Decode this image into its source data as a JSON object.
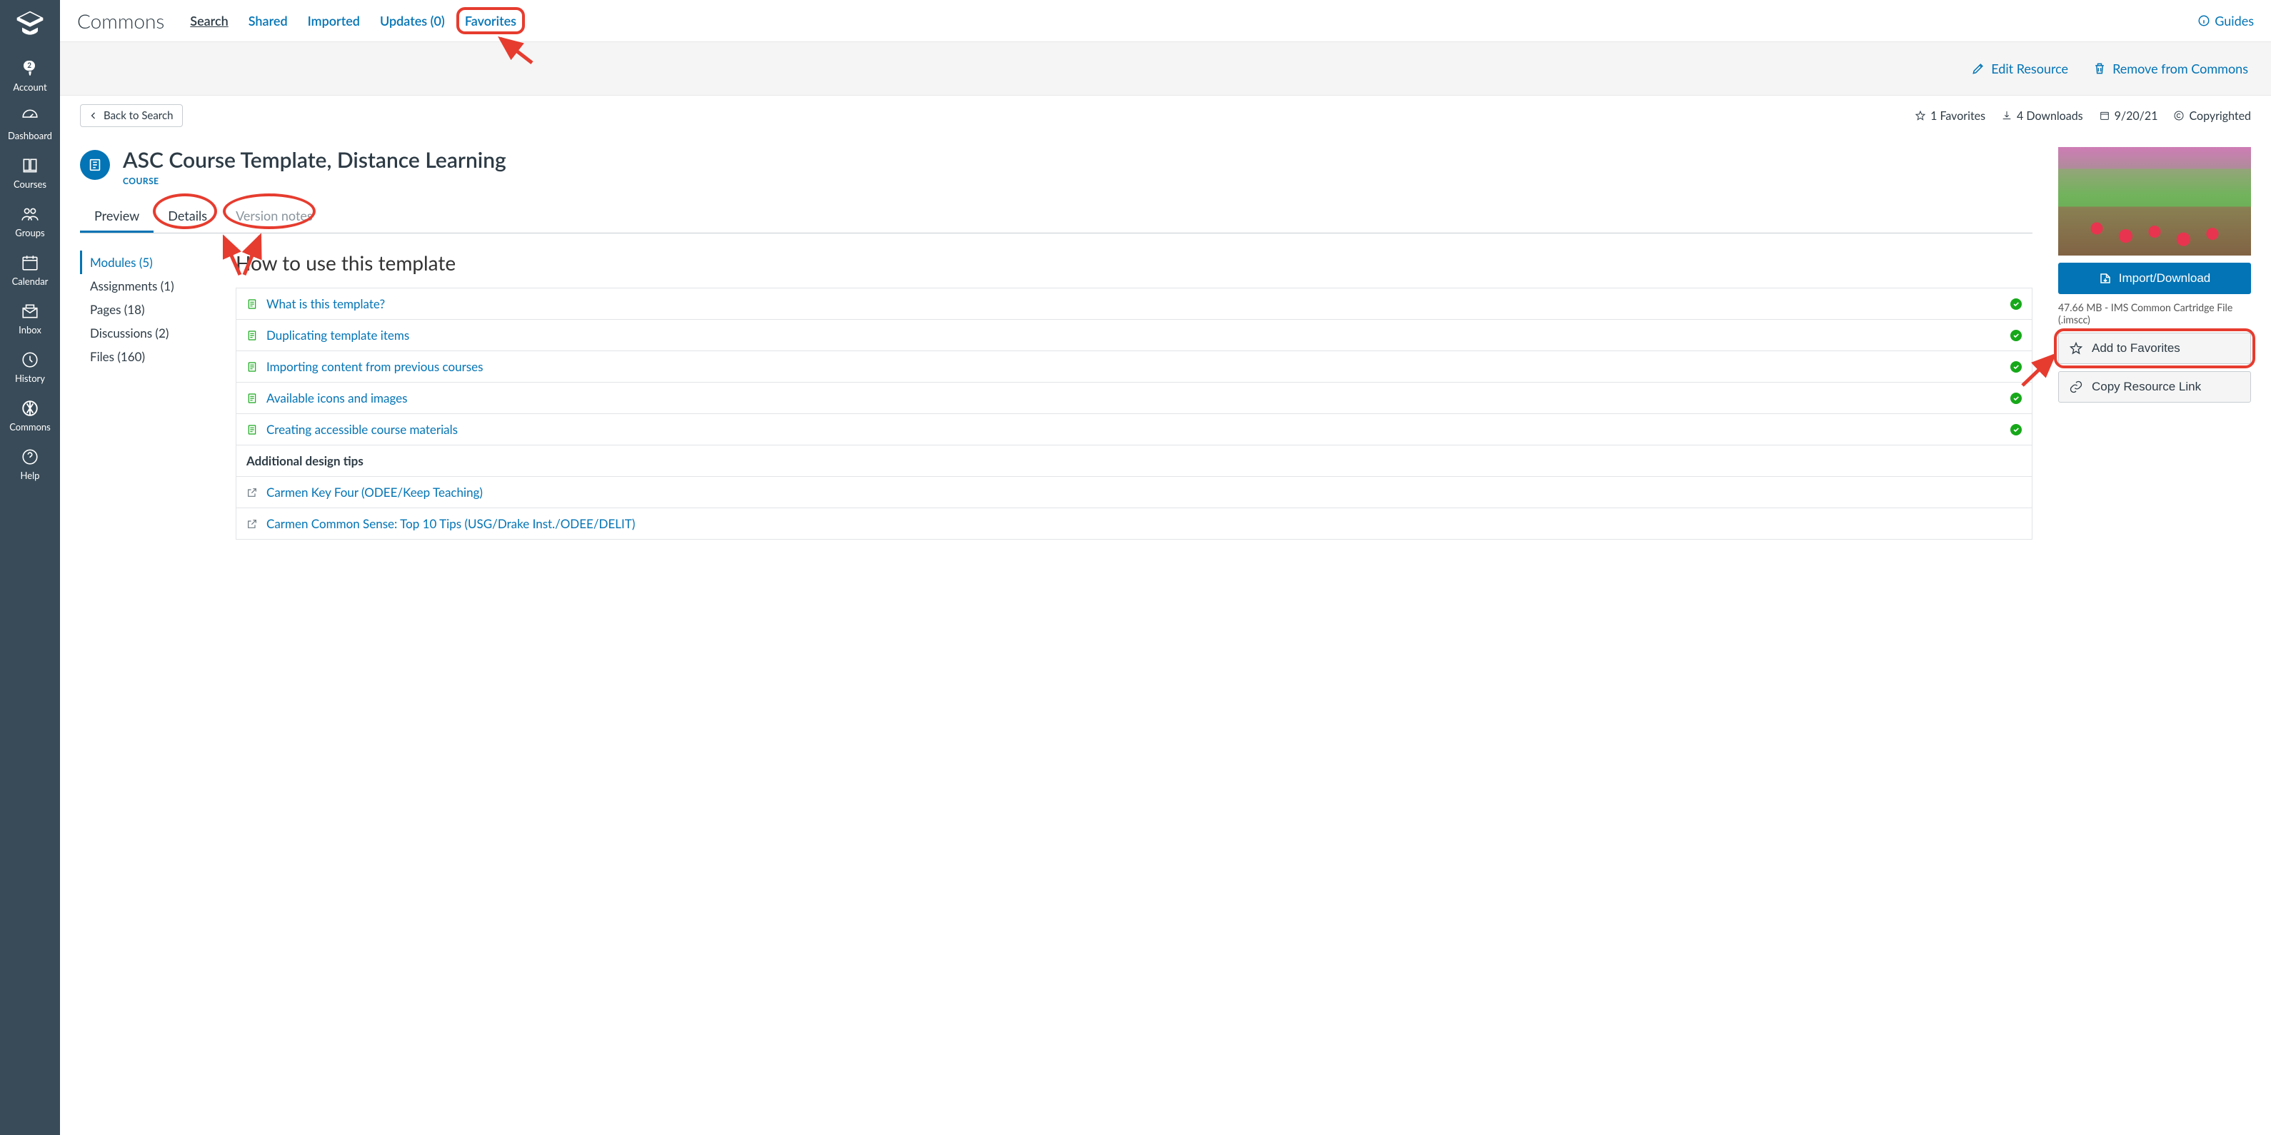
{
  "globalNav": {
    "badge": "2",
    "items": [
      {
        "label": "Account"
      },
      {
        "label": "Dashboard"
      },
      {
        "label": "Courses"
      },
      {
        "label": "Groups"
      },
      {
        "label": "Calendar"
      },
      {
        "label": "Inbox"
      },
      {
        "label": "History"
      },
      {
        "label": "Commons"
      },
      {
        "label": "Help"
      }
    ]
  },
  "header": {
    "title": "Commons",
    "tabs": {
      "search": "Search",
      "shared": "Shared",
      "imported": "Imported",
      "updates": "Updates (0)",
      "favorites": "Favorites"
    },
    "guides": "Guides"
  },
  "actionBar": {
    "edit": "Edit Resource",
    "remove": "Remove from Commons"
  },
  "backRow": {
    "back": "Back to Search",
    "favorites": "1 Favorites",
    "downloads": "4 Downloads",
    "date": "9/20/21",
    "license": "Copyrighted"
  },
  "resource": {
    "title": "ASC Course Template, Distance Learning",
    "type": "COURSE",
    "tabs": {
      "preview": "Preview",
      "details": "Details",
      "version": "Version notes"
    }
  },
  "moduleNav": {
    "modules": "Modules (5)",
    "assignments": "Assignments (1)",
    "pages": "Pages (18)",
    "discussions": "Discussions (2)",
    "files": "Files (160)"
  },
  "preview": {
    "heading": "How to use this template",
    "items": [
      {
        "label": "What is this template?",
        "type": "page",
        "check": true
      },
      {
        "label": "Duplicating template items",
        "type": "page",
        "check": true
      },
      {
        "label": "Importing content from previous courses",
        "type": "page",
        "check": true
      },
      {
        "label": "Available icons and images",
        "type": "page",
        "check": true
      },
      {
        "label": "Creating accessible course materials",
        "type": "page",
        "check": true
      }
    ],
    "subhead": "Additional design tips",
    "extItems": [
      {
        "label": "Carmen Key Four (ODEE/Keep Teaching)"
      },
      {
        "label": "Carmen Common Sense: Top 10 Tips (USG/Drake Inst./ODEE/DELIT)"
      }
    ]
  },
  "sidebar": {
    "import": "Import/Download",
    "fileMeta": "47.66 MB - IMS Common Cartridge File (.imscc)",
    "addFav": "Add to Favorites",
    "copyLink": "Copy Resource Link"
  }
}
